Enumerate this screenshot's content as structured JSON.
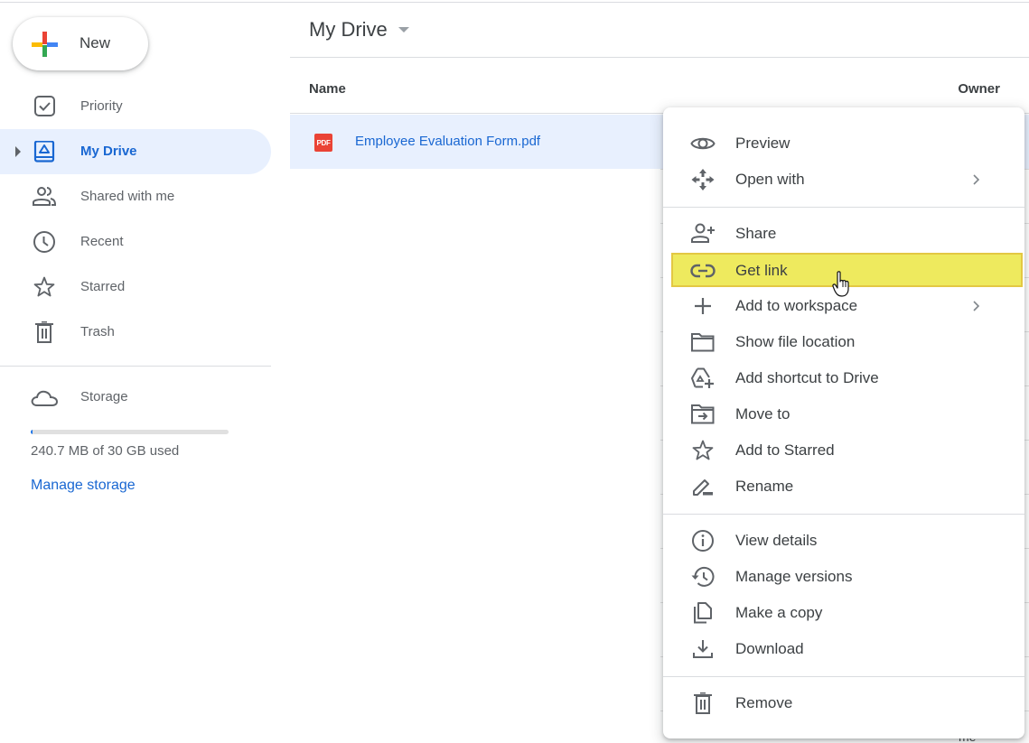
{
  "sidebar": {
    "new_button": {
      "label": "New"
    },
    "items": [
      {
        "label": "Priority",
        "icon": "priority-check-icon",
        "active": false
      },
      {
        "label": "My Drive",
        "icon": "my-drive-icon",
        "active": true
      },
      {
        "label": "Shared with me",
        "icon": "shared-people-icon",
        "active": false
      },
      {
        "label": "Recent",
        "icon": "clock-icon",
        "active": false
      },
      {
        "label": "Starred",
        "icon": "star-icon",
        "active": false
      },
      {
        "label": "Trash",
        "icon": "trash-icon",
        "active": false
      }
    ],
    "storage": {
      "label": "Storage",
      "icon": "cloud-icon",
      "usage_text": "240.7 MB of 30 GB used",
      "used_fraction": 0.008,
      "manage_link": "Manage storage"
    }
  },
  "main": {
    "title": "My Drive",
    "columns": {
      "name": "Name",
      "owner": "Owner"
    },
    "files": [
      {
        "name": "Employee Evaluation Form.pdf",
        "type_badge": "PDF",
        "selected": true
      }
    ],
    "partial_owner_text": "me"
  },
  "context_menu": {
    "groups": [
      [
        {
          "label": "Preview",
          "icon": "eye-icon"
        },
        {
          "label": "Open with",
          "icon": "open-with-arrows-icon",
          "submenu": true
        }
      ],
      [
        {
          "label": "Share",
          "icon": "person-add-icon"
        },
        {
          "label": "Get link",
          "icon": "link-icon",
          "highlighted": true
        },
        {
          "label": "Add to workspace",
          "icon": "plus-icon",
          "submenu": true
        },
        {
          "label": "Show file location",
          "icon": "folder-icon"
        },
        {
          "label": "Add shortcut to Drive",
          "icon": "drive-shortcut-icon"
        },
        {
          "label": "Move to",
          "icon": "move-to-folder-icon"
        },
        {
          "label": "Add to Starred",
          "icon": "star-icon"
        },
        {
          "label": "Rename",
          "icon": "pencil-icon"
        }
      ],
      [
        {
          "label": "View details",
          "icon": "info-icon"
        },
        {
          "label": "Manage versions",
          "icon": "history-icon"
        },
        {
          "label": "Make a copy",
          "icon": "copy-icon"
        },
        {
          "label": "Download",
          "icon": "download-icon"
        }
      ],
      [
        {
          "label": "Remove",
          "icon": "trash-icon"
        }
      ]
    ]
  },
  "colors": {
    "accent_blue": "#1967d2",
    "selection_bg": "#e8f0fe",
    "highlight_yellow": "#eeea5e",
    "pdf_red": "#ea4335"
  }
}
